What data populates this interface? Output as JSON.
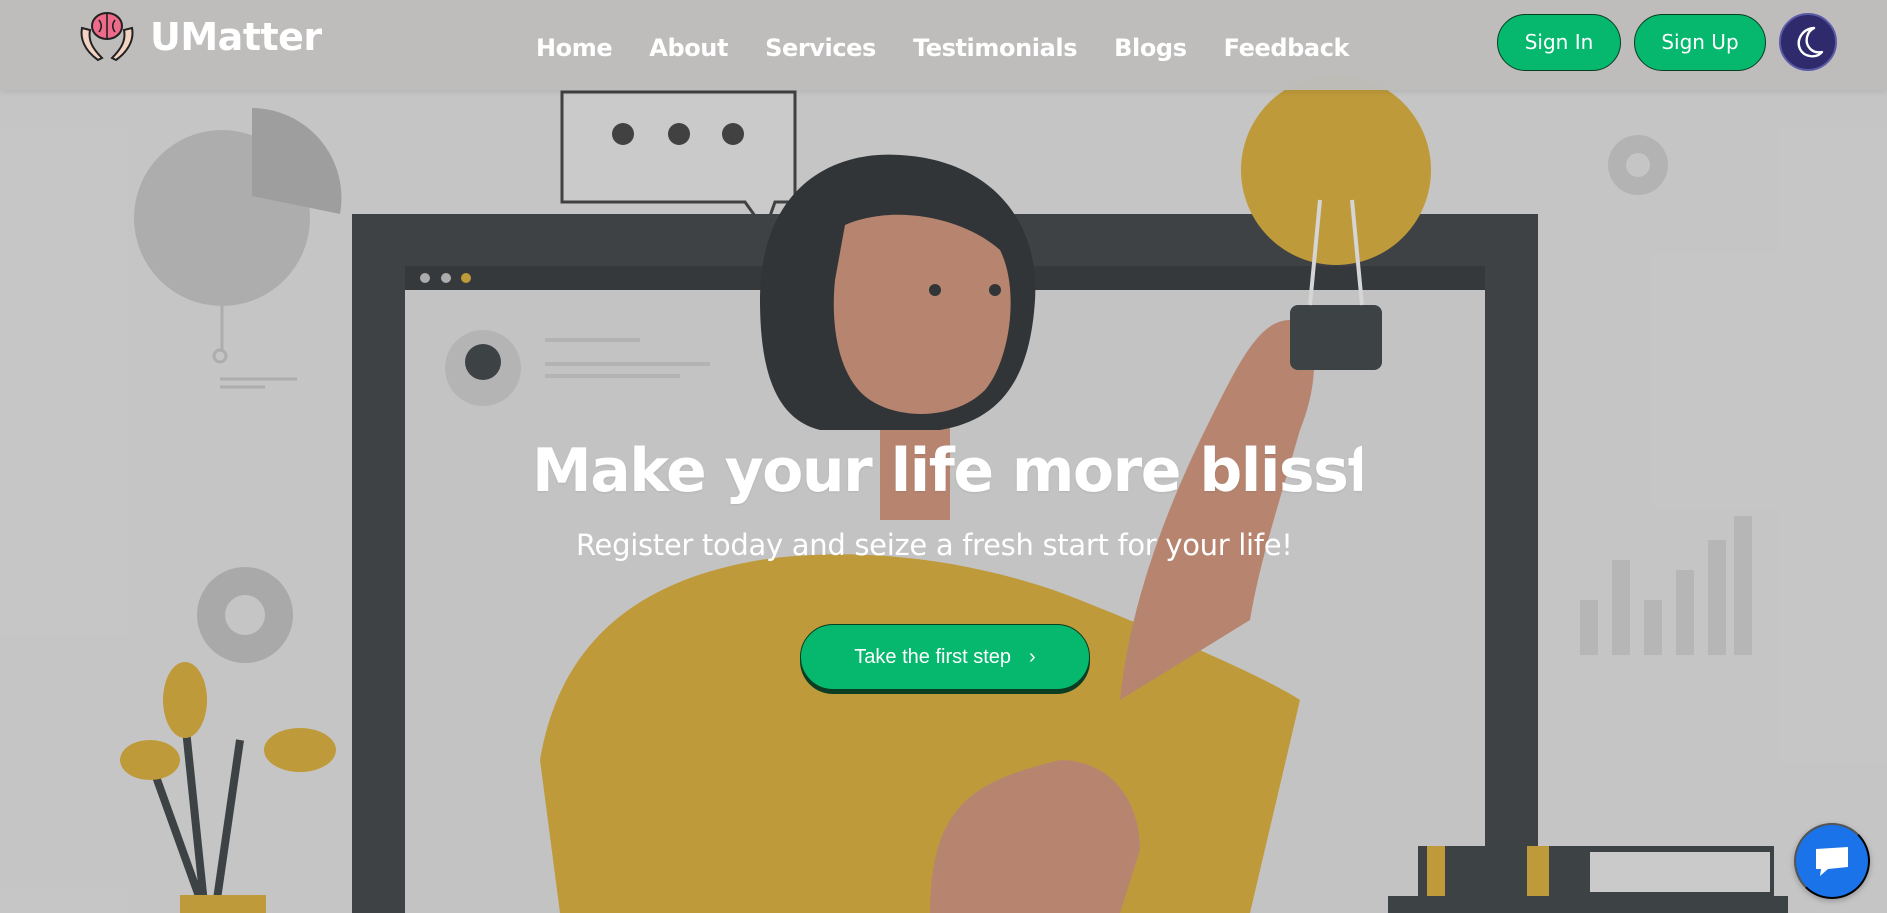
{
  "brand": {
    "name": "UMatter",
    "logo_icon": "brain-in-hands-icon"
  },
  "nav": {
    "items": [
      {
        "label": "Home"
      },
      {
        "label": "About"
      },
      {
        "label": "Services"
      },
      {
        "label": "Testimonials"
      },
      {
        "label": "Blogs"
      },
      {
        "label": "Feedback"
      }
    ]
  },
  "auth": {
    "sign_in": "Sign In",
    "sign_up": "Sign Up",
    "theme_icon": "moon-icon"
  },
  "hero": {
    "title": "Make your life more blissfu",
    "subtitle": "Register today and seize a fresh start for your life!",
    "cta_label": "Take the first step",
    "cta_icon": "chevron-right-icon"
  },
  "chat": {
    "icon": "chat-bubble-icon"
  },
  "colors": {
    "accent_green": "#06b86e",
    "navbar_bg": "#bebdbb",
    "theme_toggle_bg": "#2e2a6b",
    "chat_blue": "#1a73e8",
    "illustration_yellow": "#d4a52a",
    "illustration_dark": "#2e3438"
  }
}
